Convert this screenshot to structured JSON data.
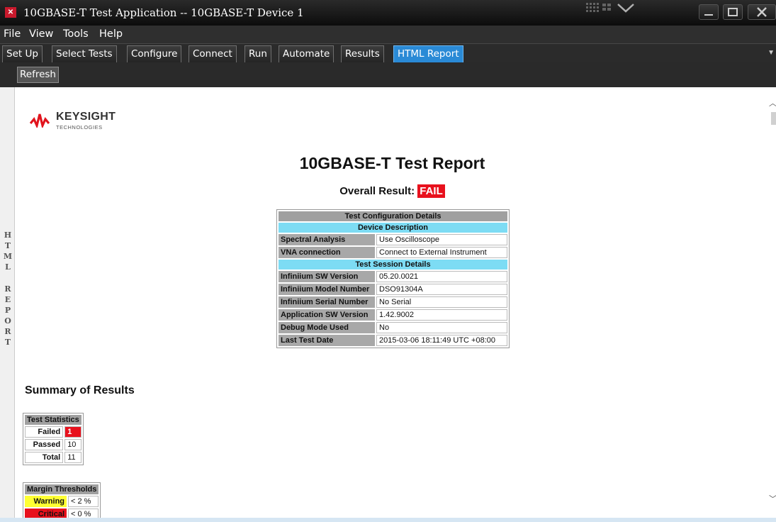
{
  "window": {
    "title": "10GBASE-T Test Application -- 10GBASE-T Device 1"
  },
  "menu": [
    "File",
    "View",
    "Tools",
    "Help"
  ],
  "tabs": [
    {
      "label": "Set Up",
      "active": false
    },
    {
      "label": "Select Tests",
      "active": false
    },
    {
      "label": "Configure",
      "active": false
    },
    {
      "label": "Connect",
      "active": false
    },
    {
      "label": "Run",
      "active": false
    },
    {
      "label": "Automate",
      "active": false
    },
    {
      "label": "Results",
      "active": false
    },
    {
      "label": "HTML Report",
      "active": true
    }
  ],
  "toolbar": {
    "refresh_label": "Refresh"
  },
  "side_panel": {
    "label": "HTML REPORT"
  },
  "report": {
    "logo_name": "KEYSIGHT",
    "logo_sub": "TECHNOLOGIES",
    "title": "10GBASE-T Test Report",
    "overall_label": "Overall Result:",
    "overall_value": "FAIL",
    "config": {
      "header": "Test Configuration Details",
      "device_header": "Device Description",
      "device_rows": [
        {
          "label": "Spectral Analysis",
          "value": "Use Oscilloscope"
        },
        {
          "label": "VNA connection",
          "value": "Connect to External Instrument"
        }
      ],
      "session_header": "Test Session Details",
      "session_rows": [
        {
          "label": "Infiniium SW Version",
          "value": "05.20.0021"
        },
        {
          "label": "Infiniium Model Number",
          "value": "DSO91304A"
        },
        {
          "label": "Infiniium Serial Number",
          "value": "No Serial"
        },
        {
          "label": "Application SW Version",
          "value": "1.42.9002"
        },
        {
          "label": "Debug Mode Used",
          "value": "No"
        },
        {
          "label": "Last Test Date",
          "value": "2015-03-06 18:11:49 UTC +08:00"
        }
      ]
    },
    "summary_title": "Summary of Results",
    "stats": {
      "header": "Test Statistics",
      "rows": [
        {
          "label": "Failed",
          "value": "1"
        },
        {
          "label": "Passed",
          "value": "10"
        },
        {
          "label": "Total",
          "value": "11"
        }
      ]
    },
    "margins": {
      "header": "Margin Thresholds",
      "rows": [
        {
          "label": "Warning",
          "value": "< 2 %"
        },
        {
          "label": "Critical",
          "value": "< 0 %"
        }
      ]
    }
  },
  "colors": {
    "accent_tab": "#2a8ad6",
    "fail": "#e8111d",
    "section_header": "#7ddcf4",
    "warning": "#ffff33",
    "logo_red": "#e1141d"
  }
}
